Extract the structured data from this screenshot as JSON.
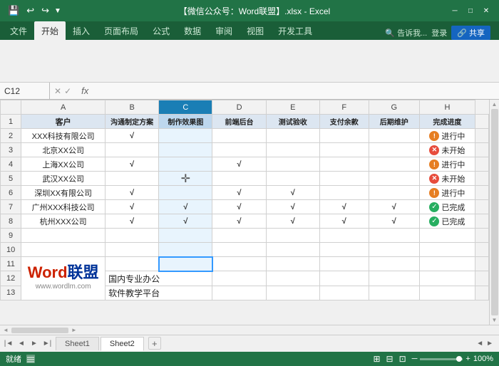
{
  "titleBar": {
    "title": "【微信公众号：Word联盟】.xlsx - Excel",
    "saveLabel": "💾",
    "undoLabel": "↩",
    "redoLabel": "↪",
    "customizeLabel": "▼"
  },
  "ribbon": {
    "tabs": [
      "文件",
      "开始",
      "插入",
      "页面布局",
      "公式",
      "数据",
      "审阅",
      "视图",
      "开发工具"
    ],
    "activeTab": "开始",
    "rightItems": {
      "search": "告诉我...",
      "login": "登录",
      "share": "共享"
    }
  },
  "formulaBar": {
    "cellRef": "C12",
    "formula": ""
  },
  "columns": {
    "headers": [
      "",
      "A",
      "B",
      "C",
      "D",
      "E",
      "F",
      "G",
      "H"
    ],
    "labels": [
      "",
      "客户",
      "沟通制定方案",
      "制作效果图",
      "前端后台",
      "测试验收",
      "支付余款",
      "后期维护",
      "完成进度"
    ]
  },
  "rows": [
    {
      "num": "2",
      "a": "XXX科技有限公司",
      "b": "√",
      "c": "",
      "d": "",
      "e": "",
      "f": "",
      "g": "",
      "h": "进行中",
      "hStatus": "in-progress"
    },
    {
      "num": "3",
      "a": "北京XX公司",
      "b": "",
      "c": "",
      "d": "",
      "e": "",
      "f": "",
      "g": "",
      "h": "未开始",
      "hStatus": "not-started"
    },
    {
      "num": "4",
      "a": "上海XX公司",
      "b": "√",
      "c": "",
      "d": "√",
      "e": "",
      "f": "",
      "g": "",
      "h": "进行中",
      "hStatus": "in-progress"
    },
    {
      "num": "5",
      "a": "武汉XX公司",
      "b": "",
      "c": "",
      "d": "",
      "e": "",
      "f": "",
      "g": "",
      "h": "未开始",
      "hStatus": "not-started"
    },
    {
      "num": "6",
      "a": "深圳XX有限公司",
      "b": "√",
      "c": "",
      "d": "√",
      "e": "√",
      "f": "",
      "g": "",
      "h": "进行中",
      "hStatus": "in-progress"
    },
    {
      "num": "7",
      "a": "广州XXX科技公司",
      "b": "√",
      "c": "√",
      "d": "√",
      "e": "√",
      "f": "√",
      "g": "√",
      "h": "已完成",
      "hStatus": "done"
    },
    {
      "num": "8",
      "a": "杭州XXX公司",
      "b": "√",
      "c": "√",
      "d": "√",
      "e": "√",
      "f": "√",
      "g": "√",
      "h": "已完成",
      "hStatus": "done"
    }
  ],
  "emptyRows": [
    "9",
    "10"
  ],
  "brandRow": {
    "wordRed": "Word",
    "wordBlue": "联盟",
    "tagline": "www.wordlm.com",
    "desc1": "国内专业办公",
    "desc2": "软件教学平台"
  },
  "brandRows": [
    "11",
    "12",
    "13"
  ],
  "sheetTabs": [
    "Sheet1",
    "Sheet2"
  ],
  "activeSheet": "Sheet2",
  "statusBar": {
    "ready": "就绪",
    "zoom": "100%"
  }
}
